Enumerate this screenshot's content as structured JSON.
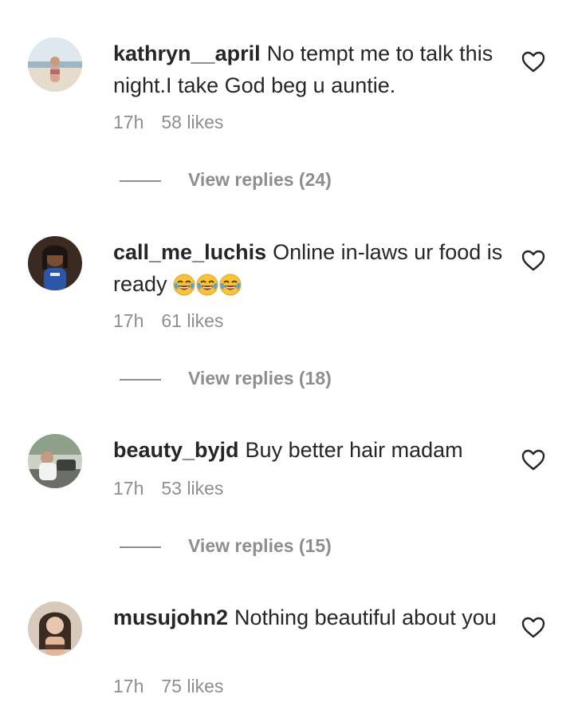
{
  "comments": [
    {
      "username": "kathryn__april",
      "text": "No tempt me to talk this night.I take God beg u auntie.",
      "time": "17h",
      "likes": "58 likes",
      "replies": "View replies (24)",
      "heart_icon": "heart-outline-icon"
    },
    {
      "username": "call_me_luchis",
      "text": "Online in-laws ur food is ready",
      "emojis": [
        "face-with-tears-of-joy",
        "face-with-tears-of-joy",
        "face-with-tears-of-joy"
      ],
      "time": "17h",
      "likes": "61 likes",
      "replies": "View replies (18)",
      "heart_icon": "heart-outline-icon"
    },
    {
      "username": "beauty_byjd",
      "text": "Buy better hair madam",
      "time": "17h",
      "likes": "53 likes",
      "replies": "View replies (15)",
      "heart_icon": "heart-outline-icon"
    },
    {
      "username": "musujohn2",
      "text": "Nothing beautiful about you",
      "time": "17h",
      "likes": "75 likes",
      "heart_icon": "heart-outline-icon"
    }
  ],
  "colors": {
    "text": "#262626",
    "secondary": "#8e8e8e",
    "background": "#ffffff"
  }
}
